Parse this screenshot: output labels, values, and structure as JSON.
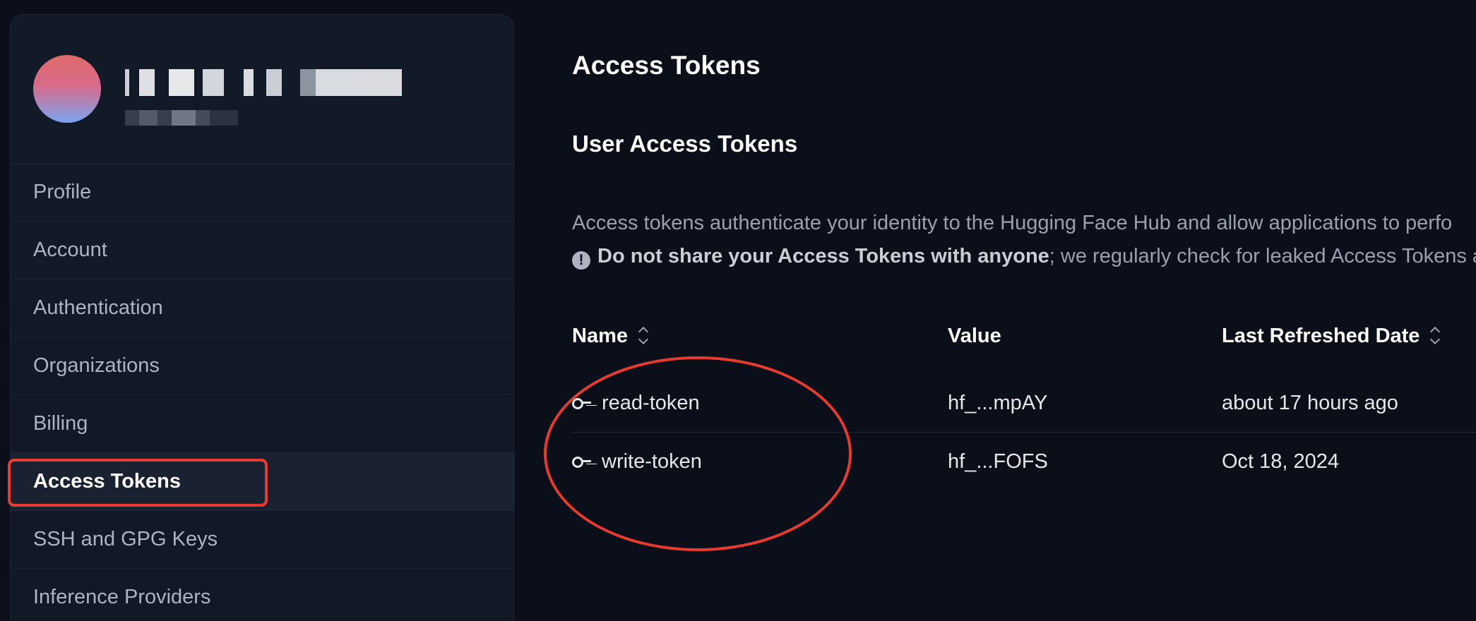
{
  "colors": {
    "background": "#0b0f19",
    "sidebar_bg": "#131a27",
    "annotation": "#e63b2e",
    "text_primary": "#ffffff",
    "text_muted": "#9aa1ad"
  },
  "sidebar": {
    "items": [
      {
        "label": "Profile"
      },
      {
        "label": "Account"
      },
      {
        "label": "Authentication"
      },
      {
        "label": "Organizations"
      },
      {
        "label": "Billing"
      },
      {
        "label": "Access Tokens"
      },
      {
        "label": "SSH and GPG Keys"
      },
      {
        "label": "Inference Providers"
      }
    ],
    "active_item": "Access Tokens"
  },
  "main": {
    "title": "Access Tokens",
    "subtitle": "User Access Tokens",
    "description_line1": "Access tokens authenticate your identity to the Hugging Face Hub and allow applications to perfo",
    "warning": {
      "icon": "exclamation-circle-icon",
      "bold_1": "Do not share your ",
      "bold_2": "Access Tokens",
      "bold_3": " with anyone",
      "rest": "; we regularly check for leaked Access Tokens a"
    },
    "table": {
      "columns": [
        "Name",
        "Value",
        "Last Refreshed Date"
      ],
      "rows": [
        {
          "name": "read-token",
          "value": "hf_...mpAY",
          "last_refreshed": "about 17 hours ago"
        },
        {
          "name": "write-token",
          "value": "hf_...FOFS",
          "last_refreshed": "Oct 18, 2024"
        }
      ]
    }
  }
}
